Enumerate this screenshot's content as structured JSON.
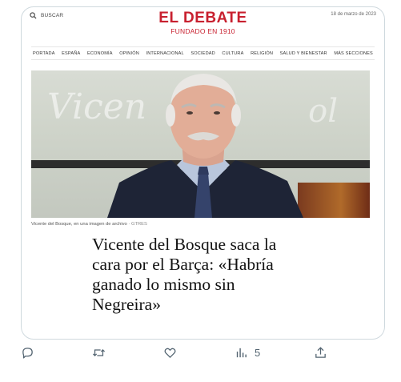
{
  "masthead": {
    "search_label": "BUSCAR",
    "logo_title": "EL DEBATE",
    "logo_subtitle": "FUNDADO EN 1910",
    "date": "18 de marzo de 2023"
  },
  "nav": {
    "items": [
      "PORTADA",
      "ESPAÑA",
      "ECONOMÍA",
      "OPINIÓN",
      "INTERNACIONAL",
      "SOCIEDAD",
      "CULTURA",
      "RELIGIÓN",
      "SALUD Y BIENESTAR",
      "MÁS SECCIONES"
    ]
  },
  "article": {
    "image_caption": "Vicente del Bosque, en una imagen de archivo",
    "image_credit": "· GTRES",
    "headline_lines": [
      "Vicente del Bosque saca la",
      "cara por el Barça: «Habría",
      "ganado lo mismo sin",
      "Negreira»"
    ]
  },
  "actions": {
    "reply_icon": "reply-icon",
    "retweet_icon": "retweet-icon",
    "like_icon": "like-icon",
    "views_icon": "views-icon",
    "views_count": "5",
    "share_icon": "share-icon"
  },
  "colors": {
    "brand": "#c8202f",
    "action_gray": "#536471"
  }
}
